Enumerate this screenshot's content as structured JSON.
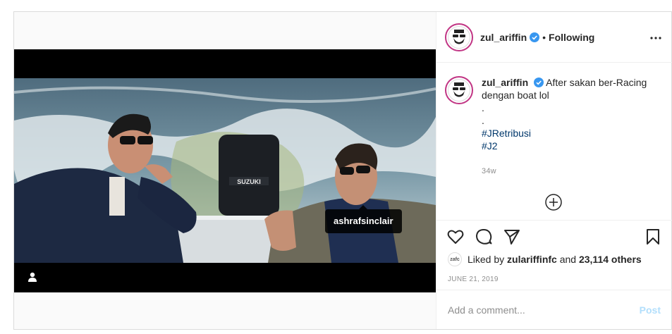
{
  "post": {
    "tagged_user": "ashrafsinclair",
    "engine_brand": "SUZUKI"
  },
  "header": {
    "username": "zul_ariffin",
    "separator": "•",
    "follow_status": "Following"
  },
  "caption": {
    "username": "zul_ariffin",
    "text": "After sakan ber-Racing dengan boat lol",
    "lines": [
      ".",
      "."
    ],
    "hashtags": [
      "#JRetribusi",
      "#J2"
    ],
    "age": "34w"
  },
  "likes": {
    "avatar_label": "zafc",
    "prefix": "Liked by",
    "user": "zulariffinfc",
    "and": "and",
    "count": "23,114 others"
  },
  "date": "JUNE 21, 2019",
  "comment": {
    "placeholder": "Add a comment...",
    "post_label": "Post"
  },
  "colors": {
    "verified": "#3897f0",
    "story_ring": "#c13584",
    "post_button_disabled": "#b2dffc"
  },
  "icons": [
    "user-tag-icon",
    "verified-icon",
    "more-icon",
    "plus-circle-icon",
    "heart-icon",
    "comment-icon",
    "share-icon",
    "bookmark-icon"
  ]
}
